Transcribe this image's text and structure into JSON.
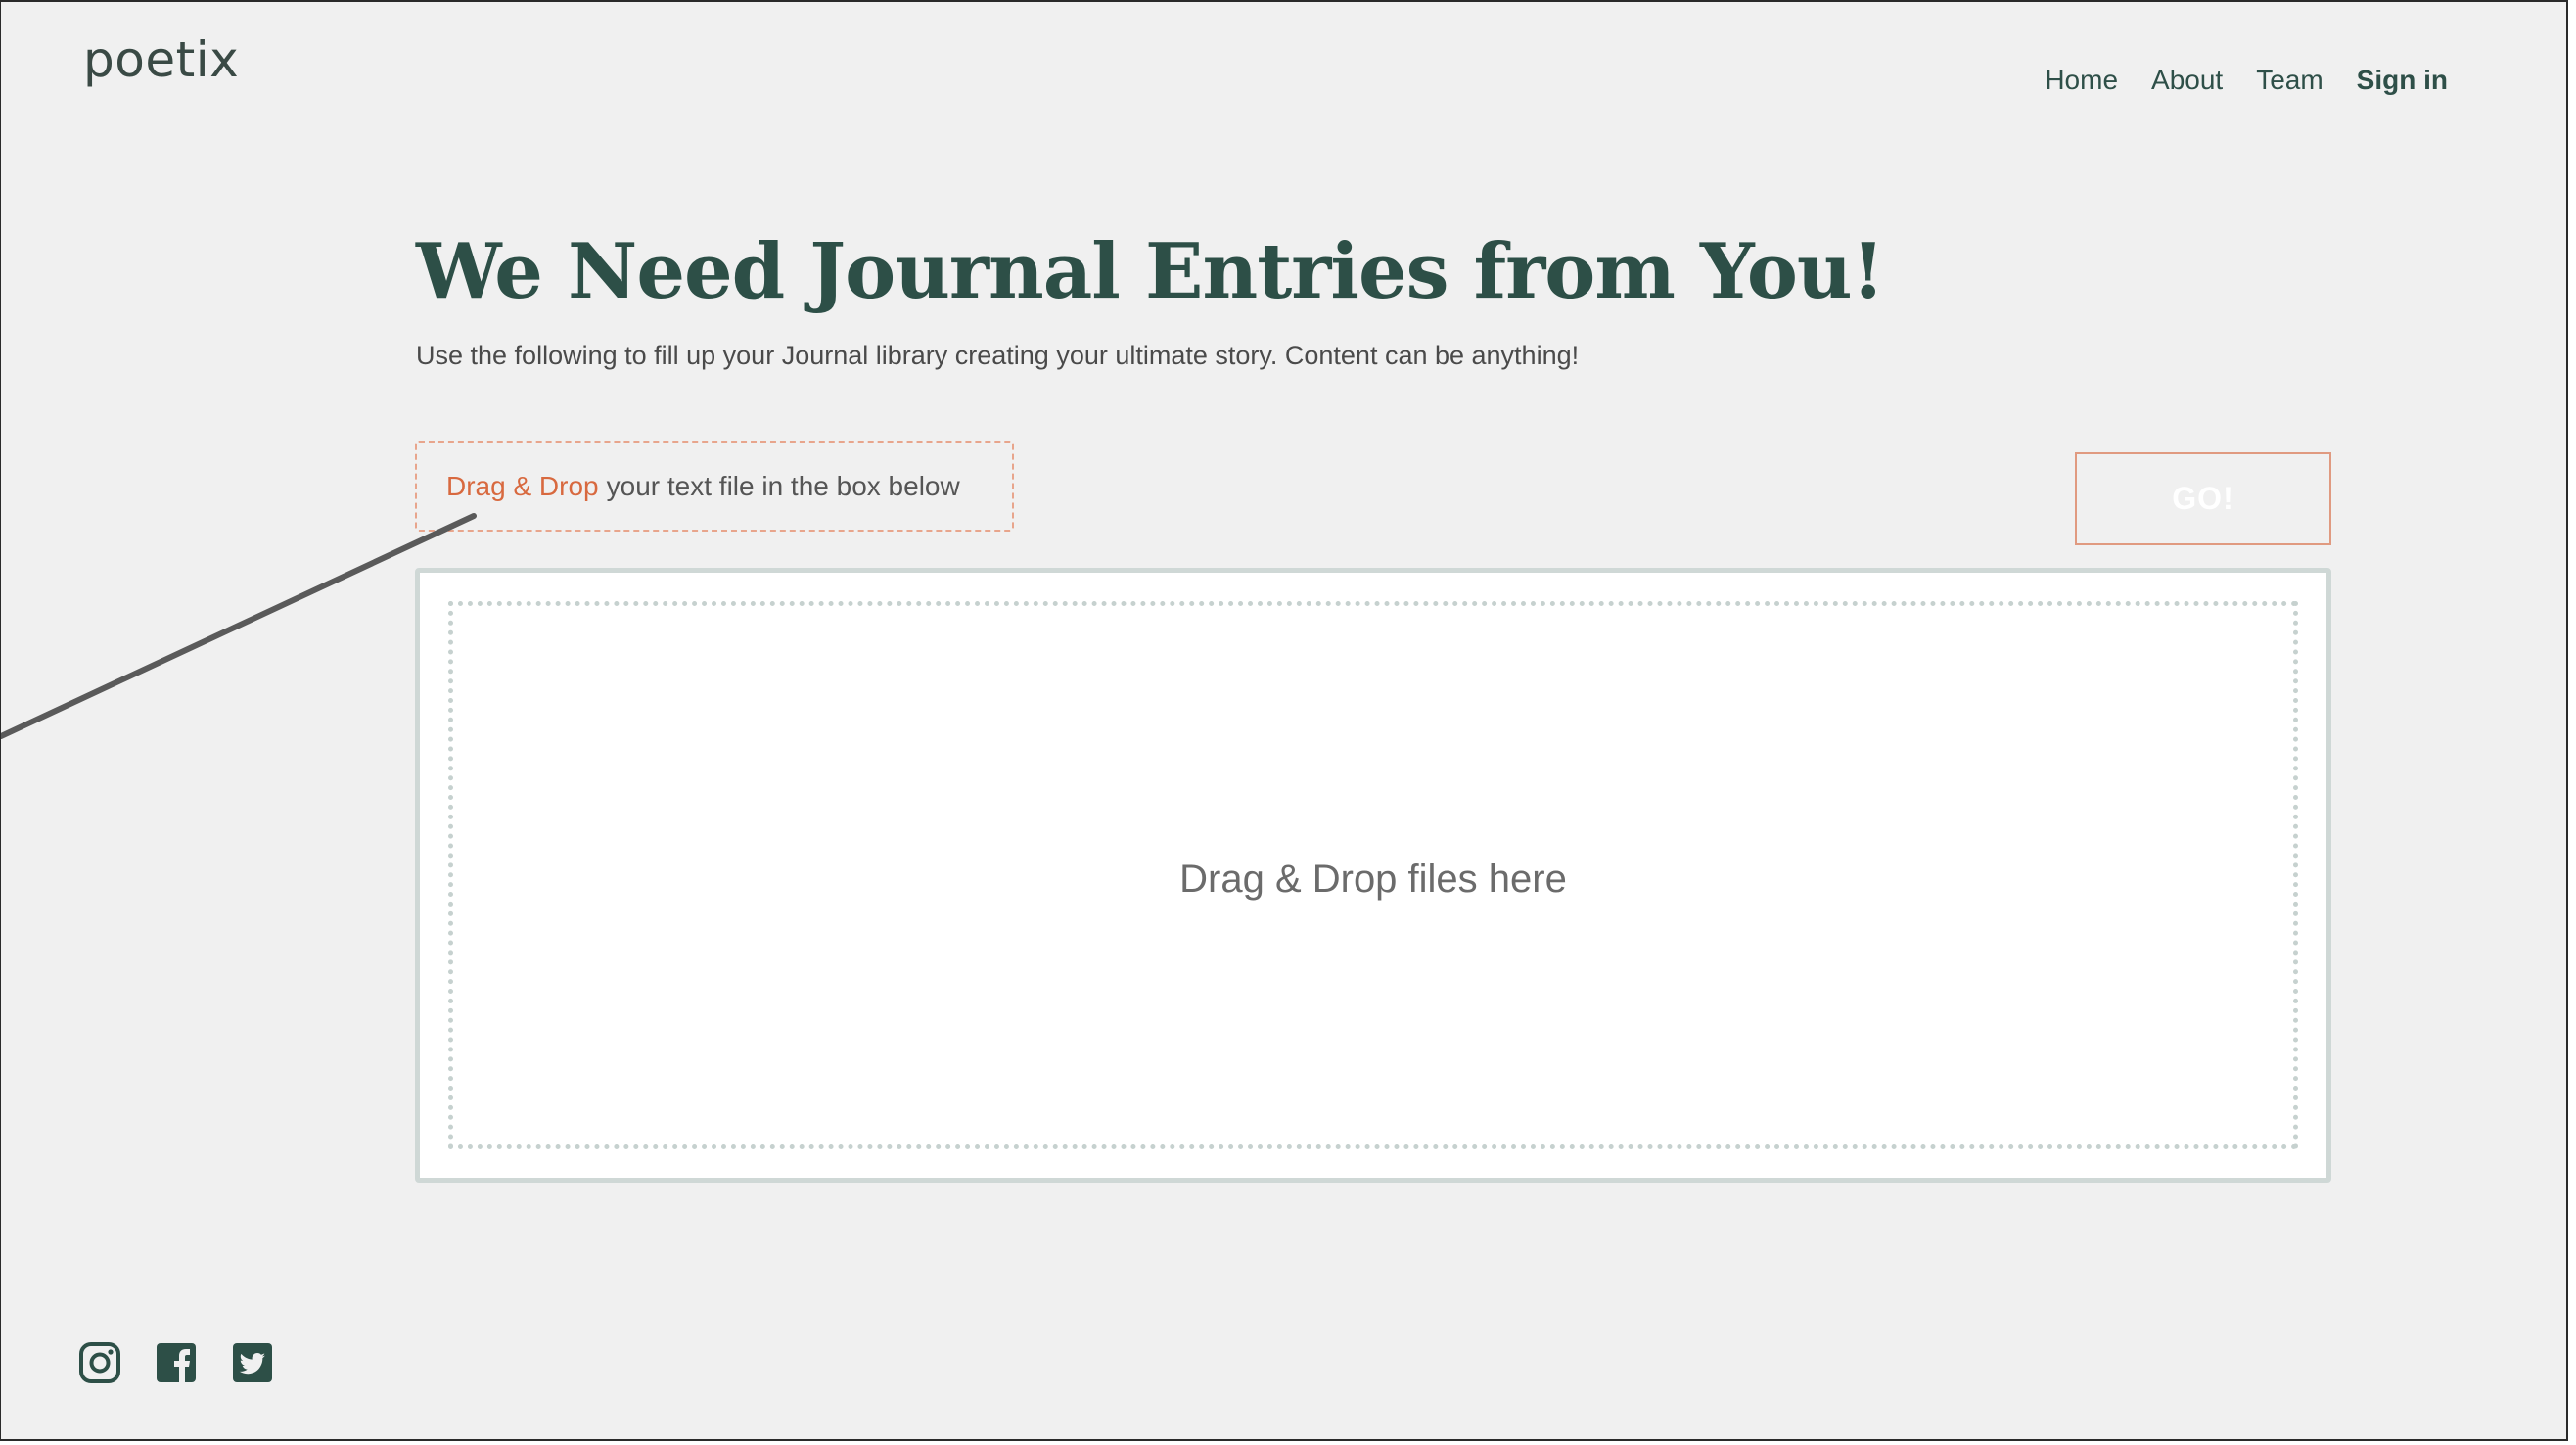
{
  "header": {
    "logo": "poetix",
    "nav": [
      {
        "label": "Home"
      },
      {
        "label": "About"
      },
      {
        "label": "Team"
      },
      {
        "label": "Sign in"
      }
    ]
  },
  "main": {
    "title": "We Need Journal Entries from You!",
    "subtitle": "Use the following to fill up your Journal library creating your ultimate story. Content can be anything!",
    "hint": {
      "accent": "Drag & Drop",
      "rest": "your text file in the box below"
    },
    "go_label": "GO!",
    "dropzone_text": "Drag & Drop files here"
  },
  "footer": {
    "social": [
      "instagram-icon",
      "facebook-icon",
      "twitter-icon"
    ]
  },
  "colors": {
    "brand_green": "#2d4f47",
    "accent_orange": "#d8693f",
    "background": "#f0f0f0"
  }
}
